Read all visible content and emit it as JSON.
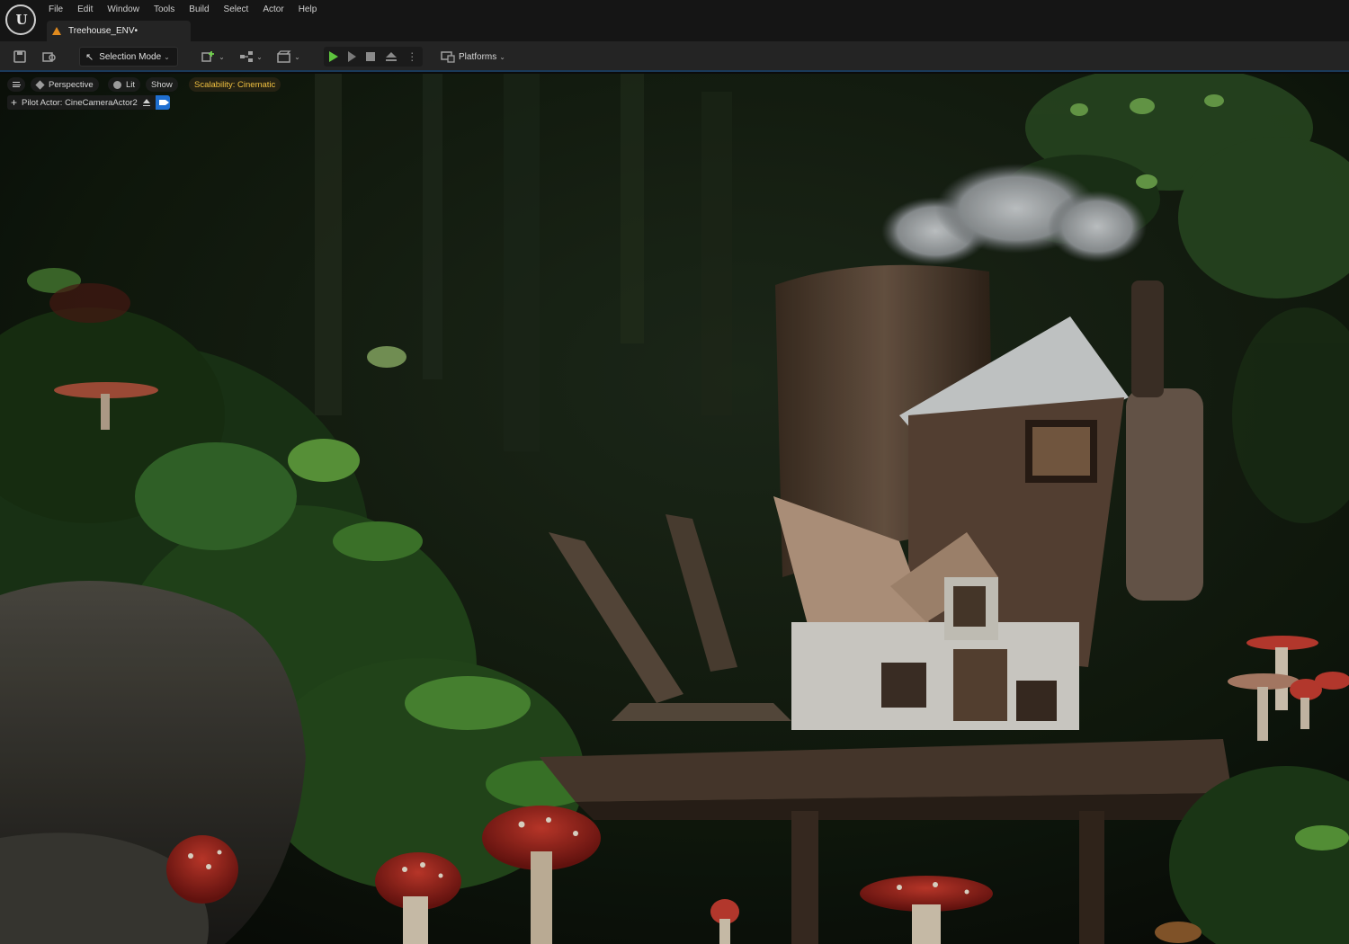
{
  "menu": {
    "items": [
      "File",
      "Edit",
      "Window",
      "Tools",
      "Build",
      "Select",
      "Actor",
      "Help"
    ]
  },
  "tab": {
    "label": "Treehouse_ENV•"
  },
  "toolbar": {
    "mode_label": "Selection Mode",
    "platforms_label": "Platforms"
  },
  "viewport": {
    "perspective_label": "Perspective",
    "lit_label": "Lit",
    "show_label": "Show",
    "scalability_label": "Scalability: Cinematic",
    "pilot_label": "Pilot Actor: CineCameraActor2"
  },
  "icons": {
    "app_logo": "unreal-engine-logo-icon",
    "save": "save-icon",
    "browse": "content-browser-icon",
    "add": "add-actor-icon",
    "blueprint": "blueprint-icon",
    "cinematics": "cinematics-icon",
    "play": "play-icon",
    "advance": "advance-frame-icon",
    "stop": "stop-icon",
    "eject": "eject-icon",
    "more": "more-options-icon",
    "platforms": "platforms-icon"
  },
  "colors": {
    "play": "#5ec43e",
    "scalability_text": "#f0c040",
    "pilot_camera": "#1f6fd1",
    "tab_warning": "#e08a1e"
  }
}
